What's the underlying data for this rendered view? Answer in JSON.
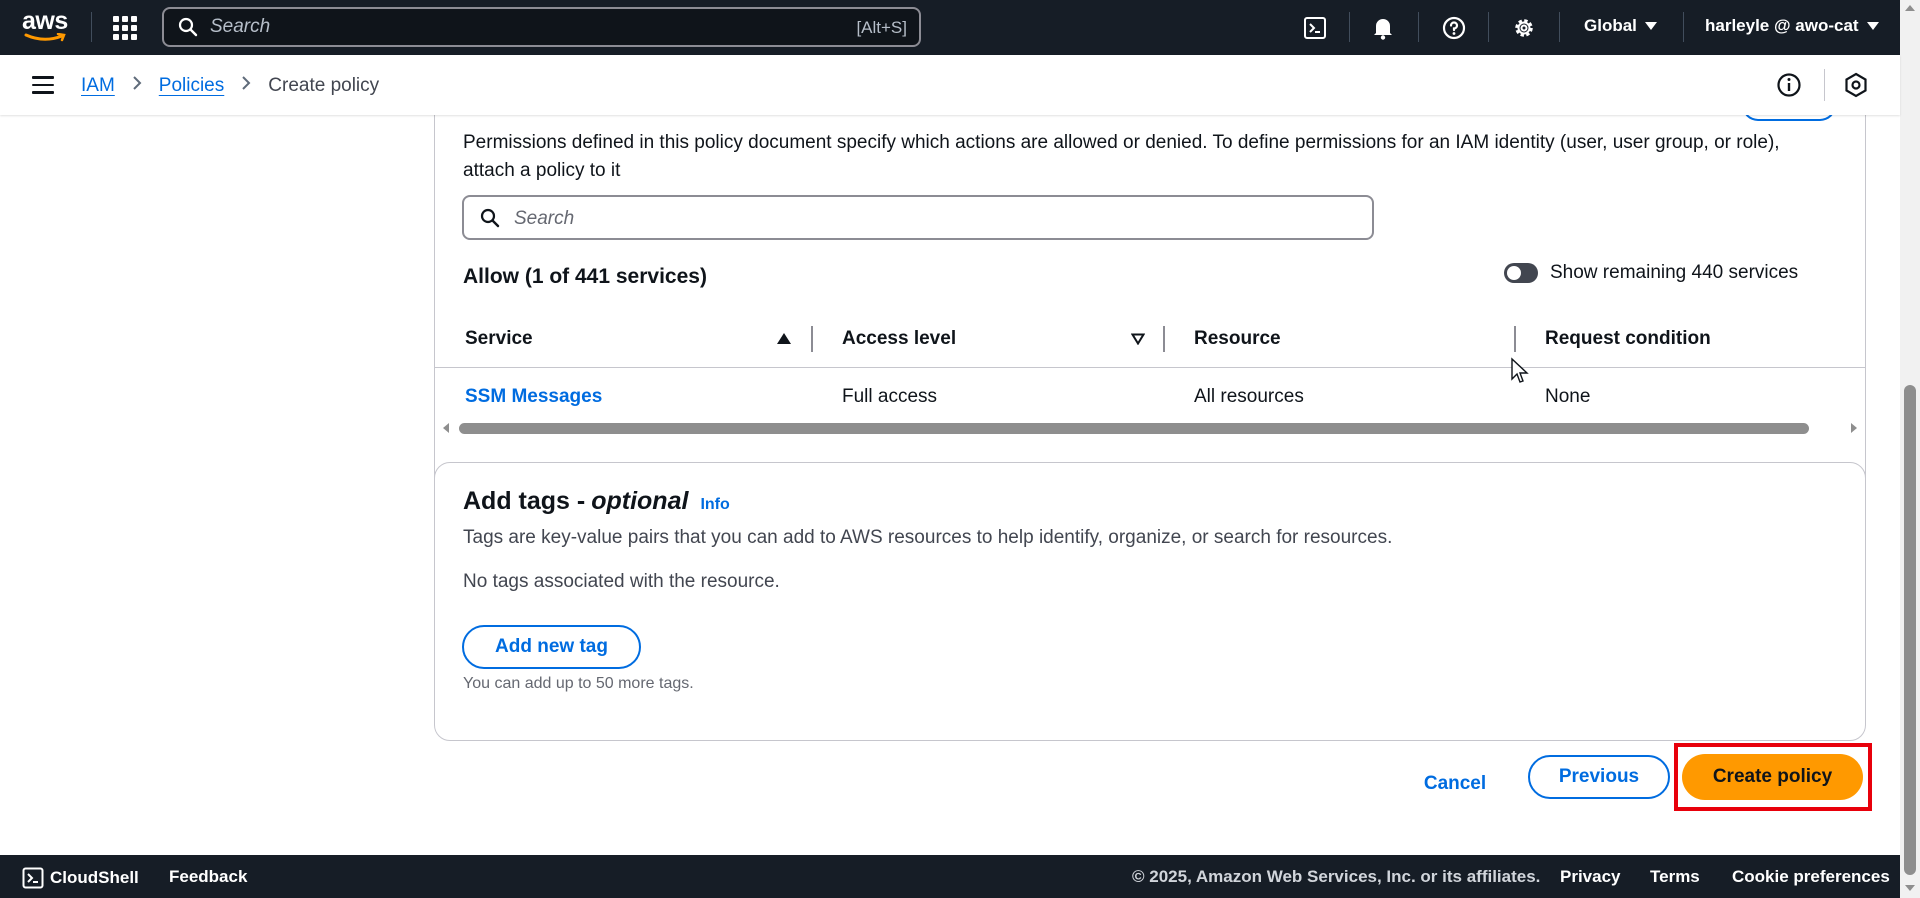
{
  "topnav": {
    "logo_text": "aws",
    "search_placeholder": "Search",
    "search_shortcut": "[Alt+S]",
    "region": "Global",
    "account": "harleyle @ awo-cat",
    "icons": [
      "apps-grid-icon",
      "cloudshell-icon",
      "bell-icon",
      "help-icon",
      "settings-icon"
    ]
  },
  "breadcrumb": {
    "items": [
      {
        "label": "IAM"
      },
      {
        "label": "Policies"
      }
    ],
    "current": "Create policy"
  },
  "permissions": {
    "description": "Permissions defined in this policy document specify which actions are allowed or denied. To define permissions for an IAM identity (user, user group, or role), attach a policy to it",
    "search_placeholder": "Search",
    "allow_title": "Allow (1 of 441 services)",
    "toggle_label": "Show remaining 440 services",
    "toggle_on": false,
    "columns": [
      "Service",
      "Access level",
      "Resource",
      "Request condition"
    ],
    "rows": [
      {
        "service": "SSM Messages",
        "access_level": "Full access",
        "resource": "All resources",
        "request_condition": "None"
      }
    ]
  },
  "tags": {
    "title": "Add tags - ",
    "title_optional": "optional",
    "info_label": "Info",
    "description": "Tags are key-value pairs that you can add to AWS resources to help identify, organize, or search for resources.",
    "empty_message": "No tags associated with the resource.",
    "add_button": "Add new tag",
    "hint": "You can add up to 50 more tags."
  },
  "actions": {
    "cancel": "Cancel",
    "previous": "Previous",
    "create": "Create policy"
  },
  "footer": {
    "cloudshell": "CloudShell",
    "feedback": "Feedback",
    "copyright": "© 2025, Amazon Web Services, Inc. or its affiliates.",
    "privacy": "Privacy",
    "terms": "Terms",
    "cookie": "Cookie preferences"
  },
  "colors": {
    "nav_bg": "#161d26",
    "link": "#006ce0",
    "primary": "#ff9900",
    "highlight": "#e8000b"
  }
}
